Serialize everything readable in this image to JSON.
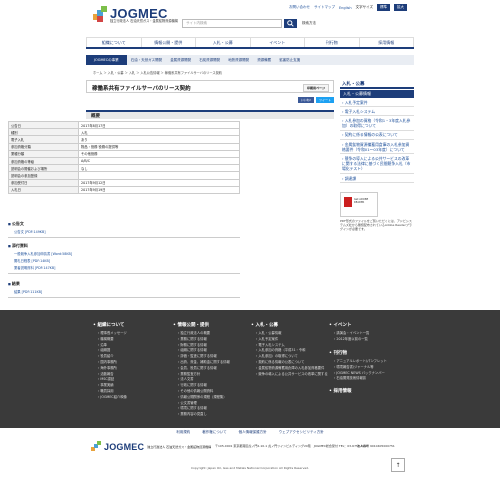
{
  "header": {
    "logo": "JOGMEC",
    "logo_sub": "独立行政法人 石油天然ガス・金属鉱物資源機構",
    "links": [
      "お問い合わせ",
      "サイトマップ",
      "English",
      "文字サイズ",
      "標準",
      "拡大"
    ],
    "search_placeholder": "サイト内検索",
    "fs_label": "検索方法"
  },
  "nav": [
    "組織について",
    "情報公開・提供",
    "入札・公募",
    "イベント",
    "刊行物",
    "採用情報"
  ],
  "subnav": [
    "JOGMECの事業",
    "石油・天然ガス開発",
    "金属資源開発",
    "石炭資源開発",
    "地熱資源開発",
    "資源備蓄",
    "鉱害防止支援"
  ],
  "breadcrumb": "ホーム ＞ 入札・公募 ＞ 入札 ＞ 入札公告情報 ＞ 稼働系共有ファイルサーバのリース契約",
  "page": {
    "title": "稼働系共有ファイルサーバのリース契約",
    "print": "印刷用ページ",
    "share": [
      "いいね!",
      "ツイート"
    ],
    "overview_heading": "概要",
    "table": [
      [
        "公告日",
        "2017年8月17日"
      ],
      [
        "種別",
        "入札"
      ],
      [
        "電子入札",
        "あり"
      ],
      [
        "参加資格分類",
        "物品・役務 役務の提供等"
      ],
      [
        "業種分類",
        "その他役務"
      ],
      [
        "参加資格の等級",
        "A/B/C"
      ],
      [
        "説明会の開催および場所",
        "なし"
      ],
      [
        "説明会の参加登録",
        ""
      ],
      [
        "参加受付日",
        "2017年9月12日"
      ],
      [
        "入札日",
        "2017年9月19日"
      ]
    ],
    "attachments": [
      {
        "heading": "公告文",
        "items": [
          "公告文 [PDF:149KB]"
        ]
      },
      {
        "heading": "添付資料",
        "items": [
          "一般競争入札参加申請書 [Word:58KB]",
          "開札日程表 [PDF:14KB]",
          "業者説明資料 [PDF:147KB]"
        ]
      },
      {
        "heading": "結果",
        "items": [
          "結果 [PDF:111KB]"
        ]
      }
    ]
  },
  "sidebar": {
    "heading": "入札・公募",
    "selected": "入札・公募情報",
    "items": [
      "入札予定案件",
      "電子入札システム",
      "入札参加の資格（令和1・3年度入札参加）の取得について",
      "契約に係る情報の公表について",
      "金属鉱物資源備蓄用倉庫の入札参加資格要件（令和01〜03年度）について",
      "競争の導入による公共サービスの改革に関する法律に基づく民間競争入札（市場化テスト）",
      "調達課"
    ],
    "adobe_title": "Get ADOBE READER",
    "adobe_note": "PDF形式のファイルをご覧いただくには、アドビシステムズ社から無償配布されているAdobe Readerプラグインが必要です。"
  },
  "footer": {
    "columns": [
      {
        "heading": "組織について",
        "items": [
          "理事長メッセージ",
          "機構概要",
          "沿革",
          "組織図",
          "役員紹介",
          "国内事務所",
          "海外事務所",
          "活動報告",
          "MSC認証",
          "事業実績",
          "職員採用",
          "JOGMEC紹介映像"
        ]
      },
      {
        "heading": "情報公開・提供",
        "items": [
          "独立行政法人の概要",
          "業務に関する情報",
          "財務に関する情報",
          "組織に関する情報",
          "評価・監査に関する情報",
          "出資、資金、補助金に関する情報",
          "会員、役員に関する情報",
          "業務監査方針",
          "法人文書",
          "行政に関する情報",
          "その他の情報公開資料",
          "情報公開関係の規程（規程集）",
          "公文書管理",
          "環境に関する情報",
          "業務内容の見直し"
        ]
      },
      {
        "heading": "入札・公募",
        "items": [
          "入札・公募情報",
          "入札予定案件",
          "電子入札システム",
          "入札参加の資格（平成31・令和",
          "入札参加）の取得について",
          "契約に係る情報の公表について",
          "金属鉱物資源備蓄用倉庫の入札参加資格要件",
          "競争の導入による公共サービスの改革に関する法律に基づく民間競争入札（市場化テスト）"
        ]
      },
      {
        "heading": "イベント",
        "items": [
          "講演会・イベント一覧",
          "2012年度以前の一覧"
        ]
      },
      {
        "heading": "刊行物",
        "items": [
          "アニュアルレポート/パンフレット",
          "環境報告書/ジャーナル等",
          "JOGMEC NEWS バックナンバー",
          "石油開発技術情報誌"
        ]
      },
      {
        "heading": "採用情報",
        "items": []
      }
    ],
    "bottom_links": [
      "利用規約",
      "著作権について",
      "個人情報保護方針",
      "ウェブアクセシビリティ方針"
    ],
    "address": "〒105-0001 東京都港区虎ノ門2-10-1 虎ノ門ツインビルディング20階　JOGMEC総合受付 TEL：03-6758-8000",
    "cert": "法人番号 9010405000751",
    "copyright": "Copyright: Japan Oil, Gas and Metals National Corporation All Rights Reserved.",
    "totop": "↑"
  },
  "colors": {
    "brand": "#1d3d7a",
    "footer_bg": "#3a3a3a"
  }
}
